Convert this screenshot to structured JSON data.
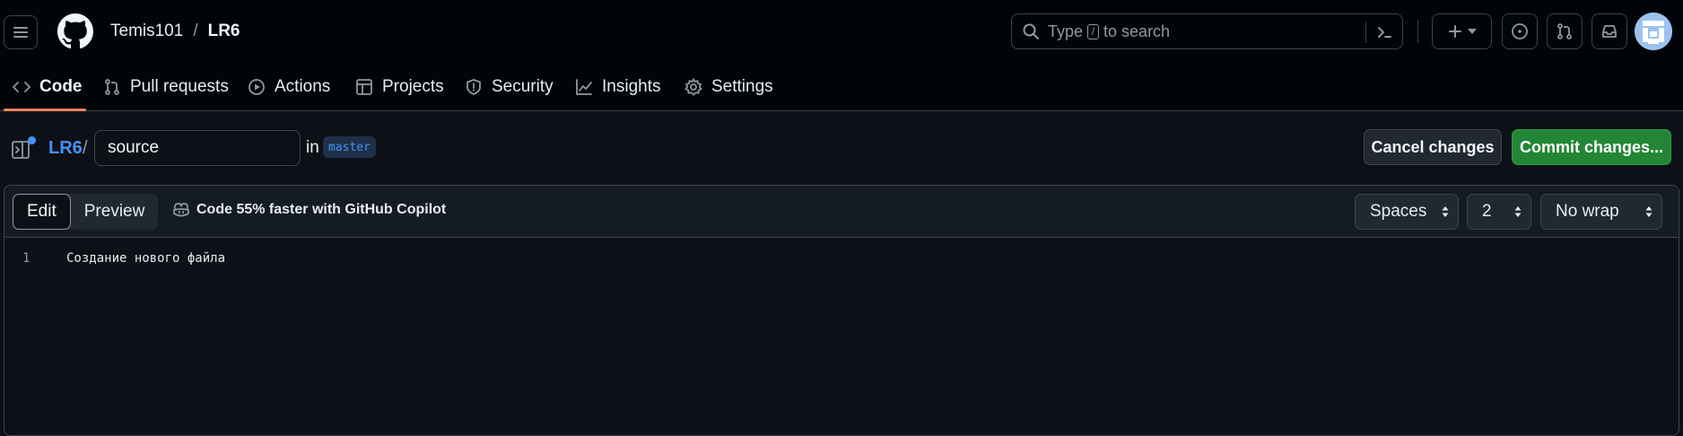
{
  "header": {
    "owner": "Temis101",
    "separator": "/",
    "repo": "LR6",
    "search_before": "Type",
    "search_key": "/",
    "search_after": "to search"
  },
  "tabs": [
    {
      "label": "Code",
      "icon": "code-icon"
    },
    {
      "label": "Pull requests",
      "icon": "git-pull-request-icon"
    },
    {
      "label": "Actions",
      "icon": "play-icon"
    },
    {
      "label": "Projects",
      "icon": "table-icon"
    },
    {
      "label": "Security",
      "icon": "shield-icon"
    },
    {
      "label": "Insights",
      "icon": "graph-icon"
    },
    {
      "label": "Settings",
      "icon": "gear-icon"
    }
  ],
  "path": {
    "repo": "LR6",
    "separator": "/",
    "filename": "source",
    "in_label": "in",
    "branch": "master"
  },
  "actions": {
    "cancel": "Cancel changes",
    "commit": "Commit changes..."
  },
  "editor": {
    "mode_edit": "Edit",
    "mode_preview": "Preview",
    "copilot": "Code 55% faster with GitHub Copilot",
    "indent_mode": "Spaces",
    "indent_size": "2",
    "wrap_mode": "No wrap",
    "lines": [
      {
        "number": "1",
        "text": "Создание нового файла"
      }
    ]
  },
  "colors": {
    "background": "#0d1117",
    "header": "#010409",
    "accent_link": "#4493f8",
    "commit_button": "#238636",
    "active_tab_underline": "#f78166"
  }
}
